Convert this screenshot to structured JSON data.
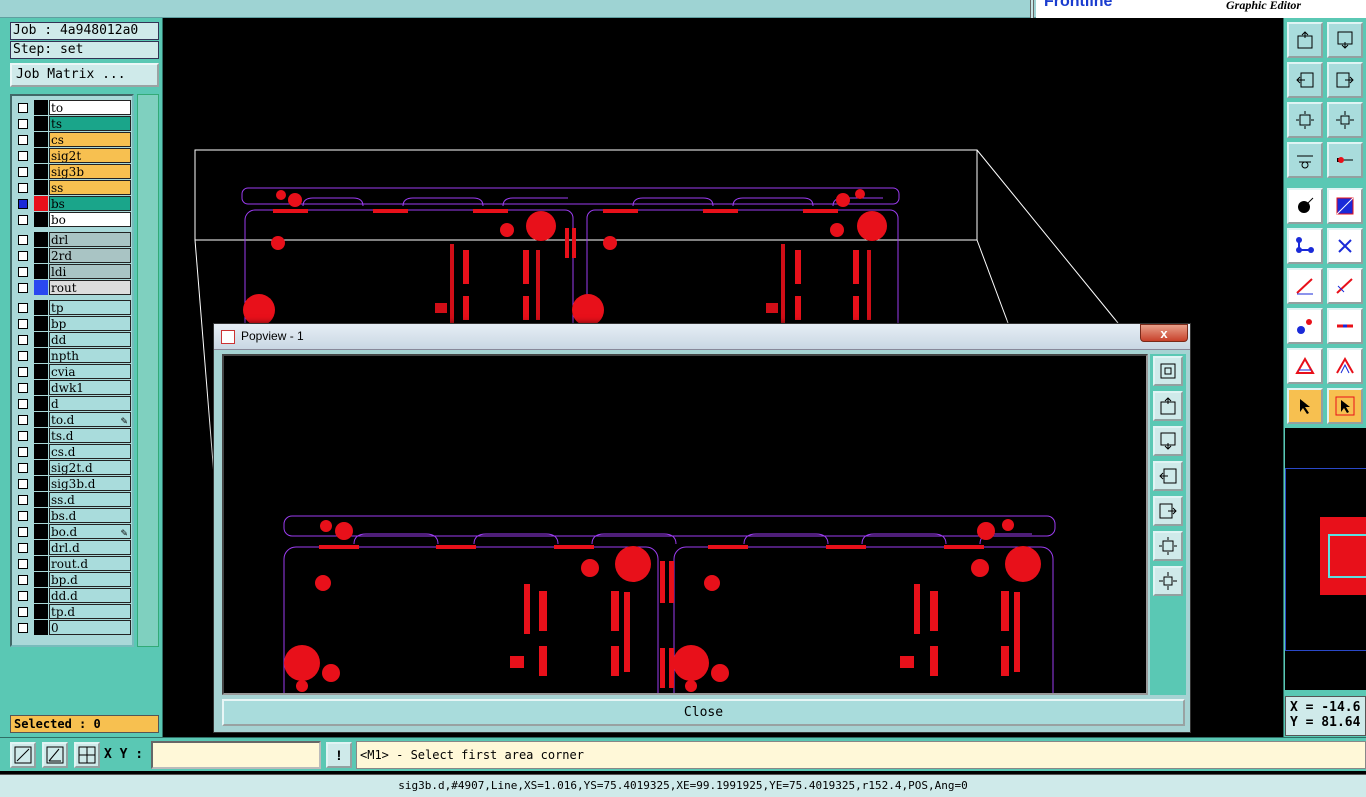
{
  "app": {
    "brand_text": "Frontline",
    "subtitle": "Graphic Editor"
  },
  "job": {
    "job_line": "Job : 4a948012a0",
    "step_line": "Step: set",
    "matrix_button": "Job Matrix ..."
  },
  "layers": [
    {
      "name": "to",
      "color": "#ffffff",
      "swatch": "#000000"
    },
    {
      "name": "ts",
      "color": "#1aa58a",
      "swatch": "#000000"
    },
    {
      "name": "cs",
      "color": "#f7c050",
      "swatch": "#000000"
    },
    {
      "name": "sig2t",
      "color": "#f7c050",
      "swatch": "#000000"
    },
    {
      "name": "sig3b",
      "color": "#f7c050",
      "swatch": "#000000"
    },
    {
      "name": "ss",
      "color": "#f7c050",
      "swatch": "#000000"
    },
    {
      "name": "bs",
      "color": "#1aa58a",
      "swatch": "#e8101a",
      "active": true
    },
    {
      "name": "bo",
      "color": "#ffffff",
      "swatch": "#000000"
    },
    {
      "name": "drl",
      "color": "#a9c4c4",
      "swatch": "#000000"
    },
    {
      "name": "2rd",
      "color": "#a9c4c4",
      "swatch": "#000000"
    },
    {
      "name": "ldi",
      "color": "#a9c4c4",
      "swatch": "#000000"
    },
    {
      "name": "rout",
      "color": "#dddddd",
      "swatch": "#2a48f0"
    },
    {
      "name": "tp",
      "color": "#a9dcdc",
      "swatch": "#000000"
    },
    {
      "name": "bp",
      "color": "#a9dcdc",
      "swatch": "#000000"
    },
    {
      "name": "dd",
      "color": "#a9dcdc",
      "swatch": "#000000"
    },
    {
      "name": "npth",
      "color": "#a9dcdc",
      "swatch": "#000000"
    },
    {
      "name": "cvia",
      "color": "#a9dcdc",
      "swatch": "#000000"
    },
    {
      "name": "dwk1",
      "color": "#a9dcdc",
      "swatch": "#000000"
    },
    {
      "name": "d",
      "color": "#a9dcdc",
      "swatch": "#000000"
    },
    {
      "name": "to.d",
      "color": "#a9dcdc",
      "swatch": "#000000",
      "mark": "✎"
    },
    {
      "name": "ts.d",
      "color": "#a9dcdc",
      "swatch": "#000000"
    },
    {
      "name": "cs.d",
      "color": "#a9dcdc",
      "swatch": "#000000"
    },
    {
      "name": "sig2t.d",
      "color": "#a9dcdc",
      "swatch": "#000000"
    },
    {
      "name": "sig3b.d",
      "color": "#a9dcdc",
      "swatch": "#000000"
    },
    {
      "name": "ss.d",
      "color": "#a9dcdc",
      "swatch": "#000000"
    },
    {
      "name": "bs.d",
      "color": "#a9dcdc",
      "swatch": "#000000"
    },
    {
      "name": "bo.d",
      "color": "#a9dcdc",
      "swatch": "#000000",
      "mark": "✎"
    },
    {
      "name": "drl.d",
      "color": "#a9dcdc",
      "swatch": "#000000"
    },
    {
      "name": "rout.d",
      "color": "#a9dcdc",
      "swatch": "#000000"
    },
    {
      "name": "bp.d",
      "color": "#a9dcdc",
      "swatch": "#000000"
    },
    {
      "name": "dd.d",
      "color": "#a9dcdc",
      "swatch": "#000000"
    },
    {
      "name": "tp.d",
      "color": "#a9dcdc",
      "swatch": "#000000"
    },
    {
      "name": "0",
      "color": "#a9dcdc",
      "swatch": "#000000"
    }
  ],
  "selected": "Selected : 0",
  "toolbar_icons": [
    "zoom-in-icon",
    "zoom-out-icon",
    "pan-left-icon",
    "pan-right-icon",
    "zoom-fit-icon",
    "zoom-home-icon",
    "measure-icon",
    "snap-icon",
    "select-pad-icon",
    "select-line-icon",
    "connect-icon",
    "cut-icon",
    "draw-line-icon",
    "draw-arc-icon",
    "add-pad-icon",
    "add-feature-icon",
    "triangle-icon",
    "triangle-outline-icon",
    "pointer-icon",
    "pointer-select-icon"
  ],
  "coords": {
    "x": "X = -14.6",
    "y": "Y = 81.64"
  },
  "command": {
    "xy_label": "X Y :",
    "xy_value": "",
    "bang": "!",
    "prompt": "<M1> - Select first area corner"
  },
  "status": "sig3b.d,#4907,Line,XS=1.016,YS=75.4019325,XE=99.1991925,YE=75.4019325,r152.4,POS,Ang=0",
  "popview": {
    "title": "Popview - 1",
    "close_x": "x",
    "close_button": "Close"
  },
  "colors": {
    "pad": "#e8101a",
    "outline": "#9b3cf0",
    "panel": "#5ac8b4"
  }
}
